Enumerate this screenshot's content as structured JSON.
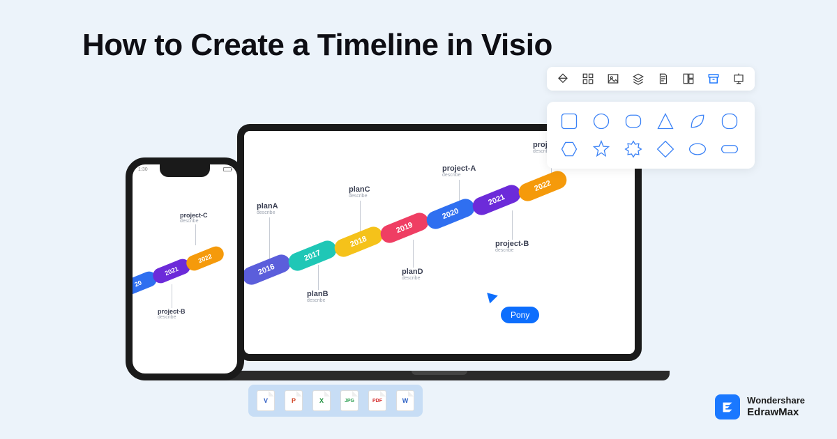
{
  "title": "How to Create a Timeline in Visio",
  "phone": {
    "time": "1:30"
  },
  "timeline": {
    "years": [
      "2016",
      "2017",
      "2018",
      "2019",
      "2020",
      "2021",
      "2022"
    ],
    "colors": [
      "#5b5edb",
      "#1fc7b6",
      "#f5c21a",
      "#ef3e63",
      "#2f6ff0",
      "#6c2bd9",
      "#f59a0b"
    ],
    "labels": {
      "planA": {
        "t": "planA",
        "s": "describe"
      },
      "planB": {
        "t": "planB",
        "s": "describe"
      },
      "planC": {
        "t": "planC",
        "s": "describe"
      },
      "planD": {
        "t": "planD",
        "s": "describe"
      },
      "projA": {
        "t": "project-A",
        "s": "describe"
      },
      "projB": {
        "t": "project-B",
        "s": "describe"
      },
      "projC": {
        "t": "project-C",
        "s": "describe"
      }
    }
  },
  "phone_timeline": {
    "years": [
      "20",
      "2021",
      "2022"
    ],
    "colors": [
      "#2f6ff0",
      "#6c2bd9",
      "#f59a0b"
    ],
    "projC": {
      "t": "project-C",
      "s": "describe"
    },
    "projB": {
      "t": "project-B",
      "s": "describe"
    }
  },
  "cursor_tag": "Pony",
  "exports": [
    {
      "label": "V",
      "color": "#2f5dc4"
    },
    {
      "label": "P",
      "color": "#d14020"
    },
    {
      "label": "X",
      "color": "#1a8f3a"
    },
    {
      "label": "JPG",
      "color": "#2a9d4f"
    },
    {
      "label": "PDF",
      "color": "#d42a2a"
    },
    {
      "label": "W",
      "color": "#2a5fc4"
    }
  ],
  "brand": {
    "top": "Wondershare",
    "bottom": "EdrawMax"
  }
}
